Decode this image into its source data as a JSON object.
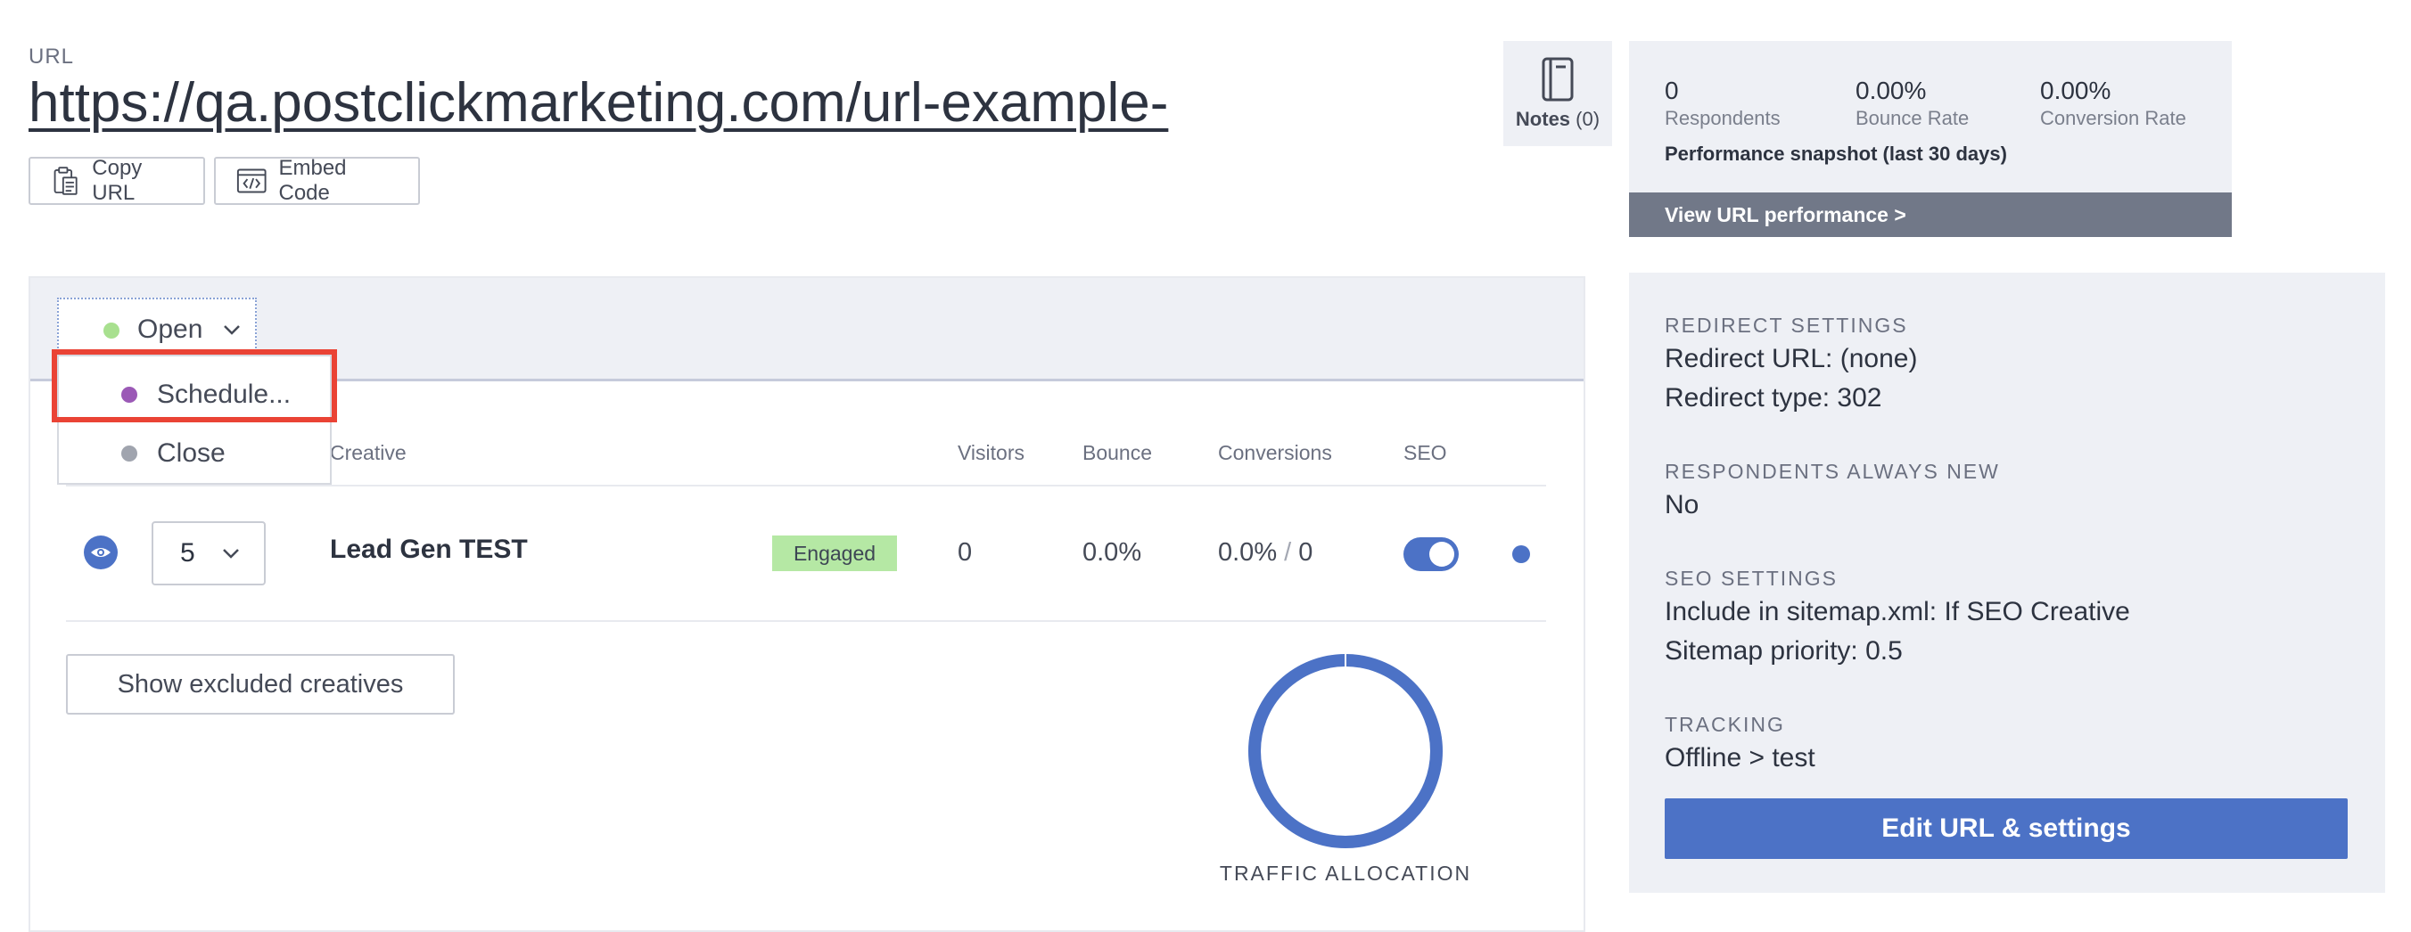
{
  "header": {
    "url_label": "URL",
    "url": "https://qa.postclickmarketing.com/url-example-",
    "copy_url_label": "Copy URL",
    "embed_code_label": "Embed Code",
    "notes_label": "Notes",
    "notes_count": "(0)"
  },
  "performance": {
    "stats": [
      {
        "value": "0",
        "label": "Respondents"
      },
      {
        "value": "0.00%",
        "label": "Bounce Rate"
      },
      {
        "value": "0.00%",
        "label": "Conversion Rate"
      }
    ],
    "title": "Performance snapshot (last 30 days)",
    "link_label": "View URL performance >"
  },
  "status": {
    "current": "Open",
    "options": [
      {
        "label": "Schedule...",
        "color": "#9b59b6"
      },
      {
        "label": "Close",
        "color": "#a0a4ae"
      }
    ],
    "open_color": "#a8e08f"
  },
  "table": {
    "headers": {
      "creative": "Creative",
      "visitors": "Visitors",
      "bounce": "Bounce",
      "conversions": "Conversions",
      "seo": "SEO"
    },
    "row": {
      "weight": "5",
      "creative": "Lead Gen TEST",
      "status": "Engaged",
      "visitors": "0",
      "bounce": "0.0%",
      "conversion_rate": "0.0%",
      "conversion_sep": "/",
      "conversions": "0",
      "seo_enabled": true
    },
    "show_excluded_label": "Show excluded creatives",
    "traffic_label": "TRAFFIC ALLOCATION",
    "traffic_allocation_fraction": 1.0
  },
  "settings": {
    "redirect_title": "REDIRECT SETTINGS",
    "redirect_url": "Redirect URL: (none)",
    "redirect_type": "Redirect type: 302",
    "respondents_title": "RESPONDENTS ALWAYS NEW",
    "respondents_value": "No",
    "seo_title": "SEO SETTINGS",
    "seo_sitemap": "Include in sitemap.xml: If SEO Creative",
    "seo_priority": "Sitemap priority: 0.5",
    "tracking_title": "TRACKING",
    "tracking_value": "Offline > test",
    "edit_label": "Edit URL & settings"
  },
  "colors": {
    "accent": "#4c72c6",
    "panel_bg": "#eef0f5",
    "highlight": "#ea4335",
    "engaged_bg": "#b5e8a4"
  }
}
